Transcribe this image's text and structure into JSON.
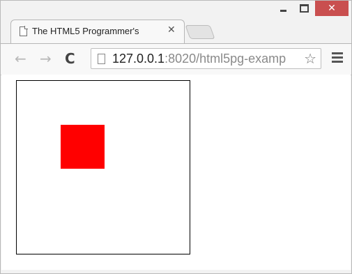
{
  "window": {
    "minimize_icon": "minimize-icon",
    "maximize_icon": "maximize-icon",
    "close_glyph": "✕"
  },
  "tab": {
    "title": "The HTML5 Programmer's",
    "close_glyph": "✕"
  },
  "toolbar": {
    "back_glyph": "←",
    "forward_glyph": "→",
    "reload_glyph": "C",
    "url_host": "127.0.0.1",
    "url_rest": ":8020/html5pg-examp",
    "star_glyph": "☆"
  },
  "canvas": {
    "rect_color": "#ff0000",
    "border_color": "#000000"
  }
}
